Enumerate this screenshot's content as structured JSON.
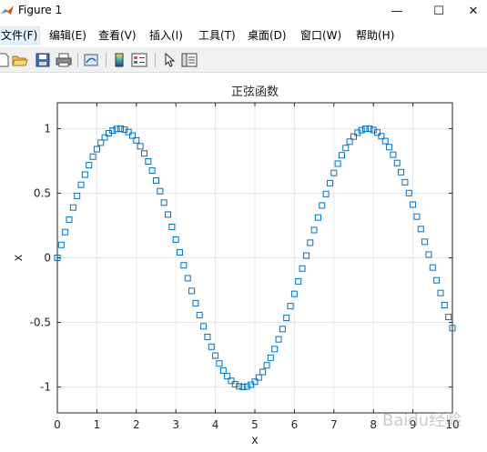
{
  "window": {
    "title": "Figure 1",
    "minimize_glyph": "—",
    "maximize_glyph": "☐",
    "close_glyph": "✕"
  },
  "menu": {
    "items": [
      {
        "label": "文件(F)"
      },
      {
        "label": "编辑(E)"
      },
      {
        "label": "查看(V)"
      },
      {
        "label": "插入(I)"
      },
      {
        "label": "工具(T)"
      },
      {
        "label": "桌面(D)"
      },
      {
        "label": "窗口(W)"
      },
      {
        "label": "帮助(H)"
      }
    ]
  },
  "toolbar": {
    "icons": [
      "new-figure-icon",
      "open-file-icon",
      "save-icon",
      "print-icon",
      "link-plot-icon",
      "insert-colorbar-icon",
      "insert-legend-icon",
      "edit-plot-arrow-icon",
      "property-inspector-icon"
    ]
  },
  "colors": {
    "series": "#0072bd",
    "grid": "#e6e6e6",
    "axes": "#262626",
    "tick_text": "#262626"
  },
  "chart_data": {
    "type": "scatter",
    "title": "正弦函数",
    "xlabel": "x",
    "ylabel": "x",
    "xlim": [
      0,
      10
    ],
    "ylim": [
      -1.2,
      1.2
    ],
    "xticks": [
      0,
      1,
      2,
      3,
      4,
      5,
      6,
      7,
      8,
      9,
      10
    ],
    "yticks": [
      -1,
      -0.5,
      0,
      0.5,
      1
    ],
    "xtick_labels": [
      "0",
      "1",
      "2",
      "3",
      "4",
      "5",
      "6",
      "7",
      "8",
      "9",
      "10"
    ],
    "ytick_labels": [
      "-1",
      "-0.5",
      "0",
      "0.5",
      "1"
    ],
    "grid": true,
    "marker": "square",
    "series": [
      {
        "x": [
          0.0,
          0.1,
          0.2,
          0.3,
          0.4,
          0.5,
          0.6,
          0.7,
          0.8,
          0.9,
          1.0,
          1.1,
          1.2,
          1.3,
          1.4,
          1.5,
          1.6,
          1.7,
          1.8,
          1.9,
          2.0,
          2.1,
          2.2,
          2.3,
          2.4,
          2.5,
          2.6,
          2.7,
          2.8,
          2.9,
          3.0,
          3.1,
          3.2,
          3.3,
          3.4,
          3.5,
          3.6,
          3.7,
          3.8,
          3.9,
          4.0,
          4.1,
          4.2,
          4.3,
          4.4,
          4.5,
          4.6,
          4.7,
          4.8,
          4.9,
          5.0,
          5.1,
          5.2,
          5.3,
          5.4,
          5.5,
          5.6,
          5.7,
          5.8,
          5.9,
          6.0,
          6.1,
          6.2,
          6.3,
          6.4,
          6.5,
          6.6,
          6.7,
          6.8,
          6.9,
          7.0,
          7.1,
          7.2,
          7.3,
          7.4,
          7.5,
          7.6,
          7.7,
          7.8,
          7.9,
          8.0,
          8.1,
          8.2,
          8.3,
          8.4,
          8.5,
          8.6,
          8.7,
          8.8,
          8.9,
          9.0,
          9.1,
          9.2,
          9.3,
          9.4,
          9.5,
          9.6,
          9.7,
          9.8,
          9.9,
          10.0
        ],
        "y": [
          0.0,
          0.1,
          0.199,
          0.296,
          0.389,
          0.479,
          0.565,
          0.644,
          0.717,
          0.783,
          0.841,
          0.891,
          0.932,
          0.964,
          0.985,
          0.997,
          1.0,
          0.992,
          0.974,
          0.946,
          0.909,
          0.863,
          0.808,
          0.746,
          0.675,
          0.598,
          0.516,
          0.427,
          0.335,
          0.239,
          0.141,
          0.042,
          -0.058,
          -0.158,
          -0.256,
          -0.351,
          -0.443,
          -0.53,
          -0.612,
          -0.688,
          -0.757,
          -0.818,
          -0.872,
          -0.916,
          -0.952,
          -0.978,
          -0.994,
          -1.0,
          -0.996,
          -0.982,
          -0.959,
          -0.926,
          -0.883,
          -0.832,
          -0.773,
          -0.706,
          -0.631,
          -0.551,
          -0.465,
          -0.374,
          -0.279,
          -0.182,
          -0.083,
          0.017,
          0.117,
          0.215,
          0.312,
          0.405,
          0.494,
          0.578,
          0.657,
          0.729,
          0.794,
          0.85,
          0.899,
          0.938,
          0.968,
          0.988,
          0.998,
          0.999,
          0.989,
          0.97,
          0.941,
          0.904,
          0.857,
          0.798,
          0.734,
          0.663,
          0.585,
          0.501,
          0.412,
          0.319,
          0.223,
          0.124,
          0.025,
          -0.075,
          -0.174,
          -0.272,
          -0.366,
          -0.458,
          -0.544
        ]
      }
    ]
  },
  "watermark": "Baidu经验"
}
